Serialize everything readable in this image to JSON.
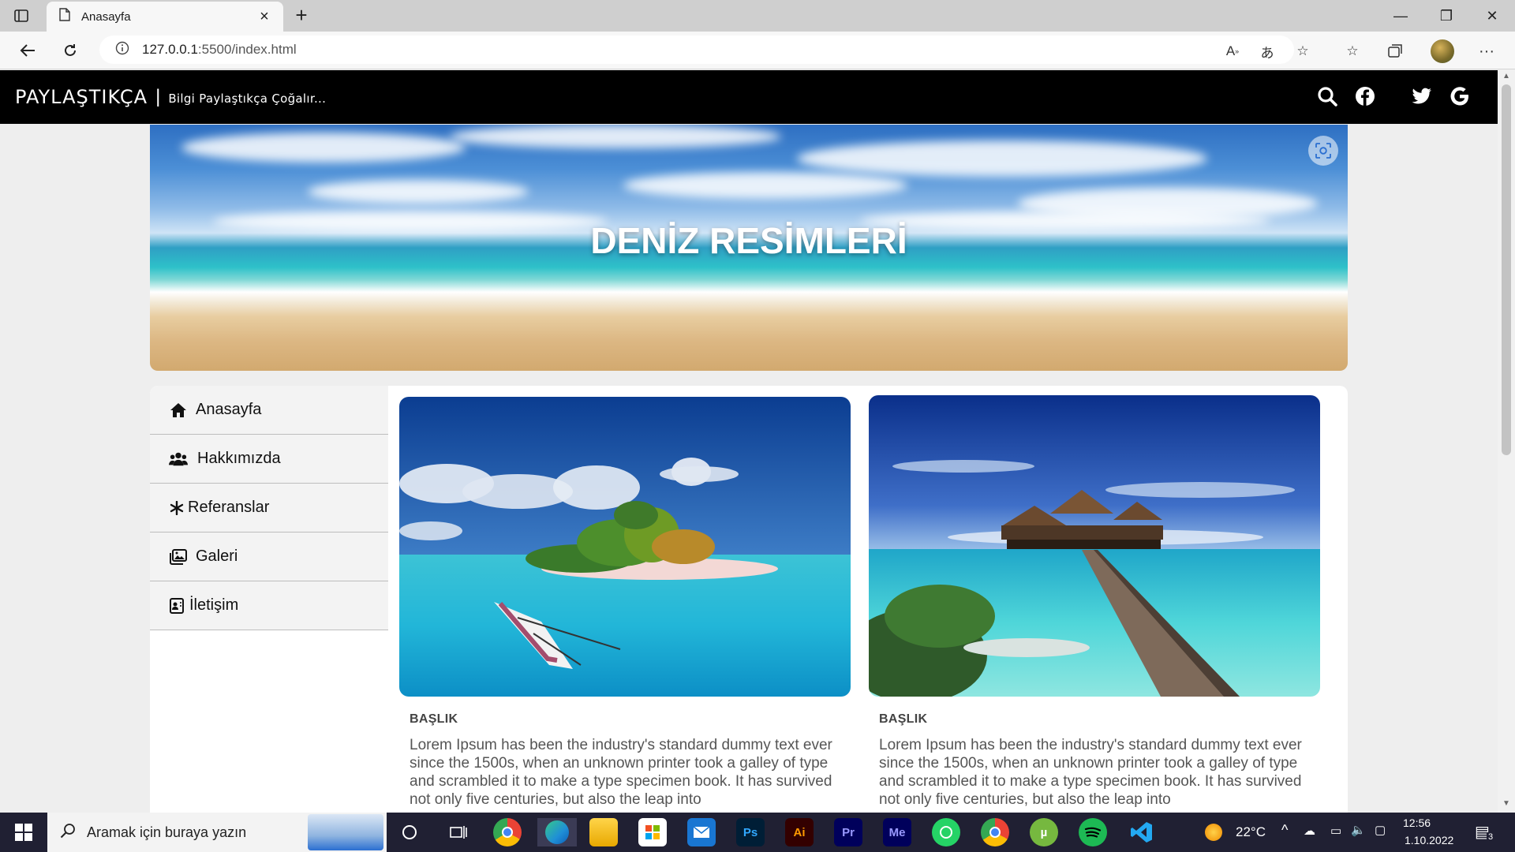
{
  "browser": {
    "tab_title": "Anasayfa",
    "new_tab": "+",
    "close_tab": "×",
    "url_host": "127.0.0.1",
    "url_path": ":5500/index.html",
    "window": {
      "minimize": "—",
      "restore": "❐",
      "close": "✕"
    }
  },
  "site": {
    "brand": "PAYLAŞTIKÇA",
    "separator": "|",
    "tagline": "Bilgi Paylaştıkça Çoğalır...",
    "hero_title": "DENİZ RESİMLERİ",
    "header_icons": [
      "search-icon",
      "facebook-icon",
      "twitter-icon",
      "google-icon"
    ]
  },
  "sidebar": {
    "items": [
      {
        "label": "Anasayfa",
        "icon": "home-icon"
      },
      {
        "label": "Hakkımızda",
        "icon": "users-icon"
      },
      {
        "label": "Referanslar",
        "icon": "asterisk-icon"
      },
      {
        "label": "Galeri",
        "icon": "images-icon"
      },
      {
        "label": "İletişim",
        "icon": "contact-card-icon"
      }
    ]
  },
  "cards": [
    {
      "title": "BAŞLIK",
      "text": "Lorem Ipsum has been the industry's standard dummy text ever since the 1500s, when an unknown printer took a galley of type and scrambled it to make a type specimen book. It has survived not only five centuries, but also the leap into"
    },
    {
      "title": "BAŞLIK",
      "text": "Lorem Ipsum has been the industry's standard dummy text ever since the 1500s, when an unknown printer took a galley of type and scrambled it to make a type specimen book. It has survived not only five centuries, but also the leap into"
    }
  ],
  "taskbar": {
    "search_placeholder": "Aramak için buraya yazın",
    "apps": [
      "Ps",
      "Ai",
      "Pr",
      "Me"
    ],
    "temperature": "22°C",
    "time": "12:56",
    "date": "1.10.2022",
    "notifications": "3"
  },
  "colors": {
    "header_bg": "#000000",
    "page_bg": "#eeeeee",
    "taskbar_bg": "#202033"
  }
}
